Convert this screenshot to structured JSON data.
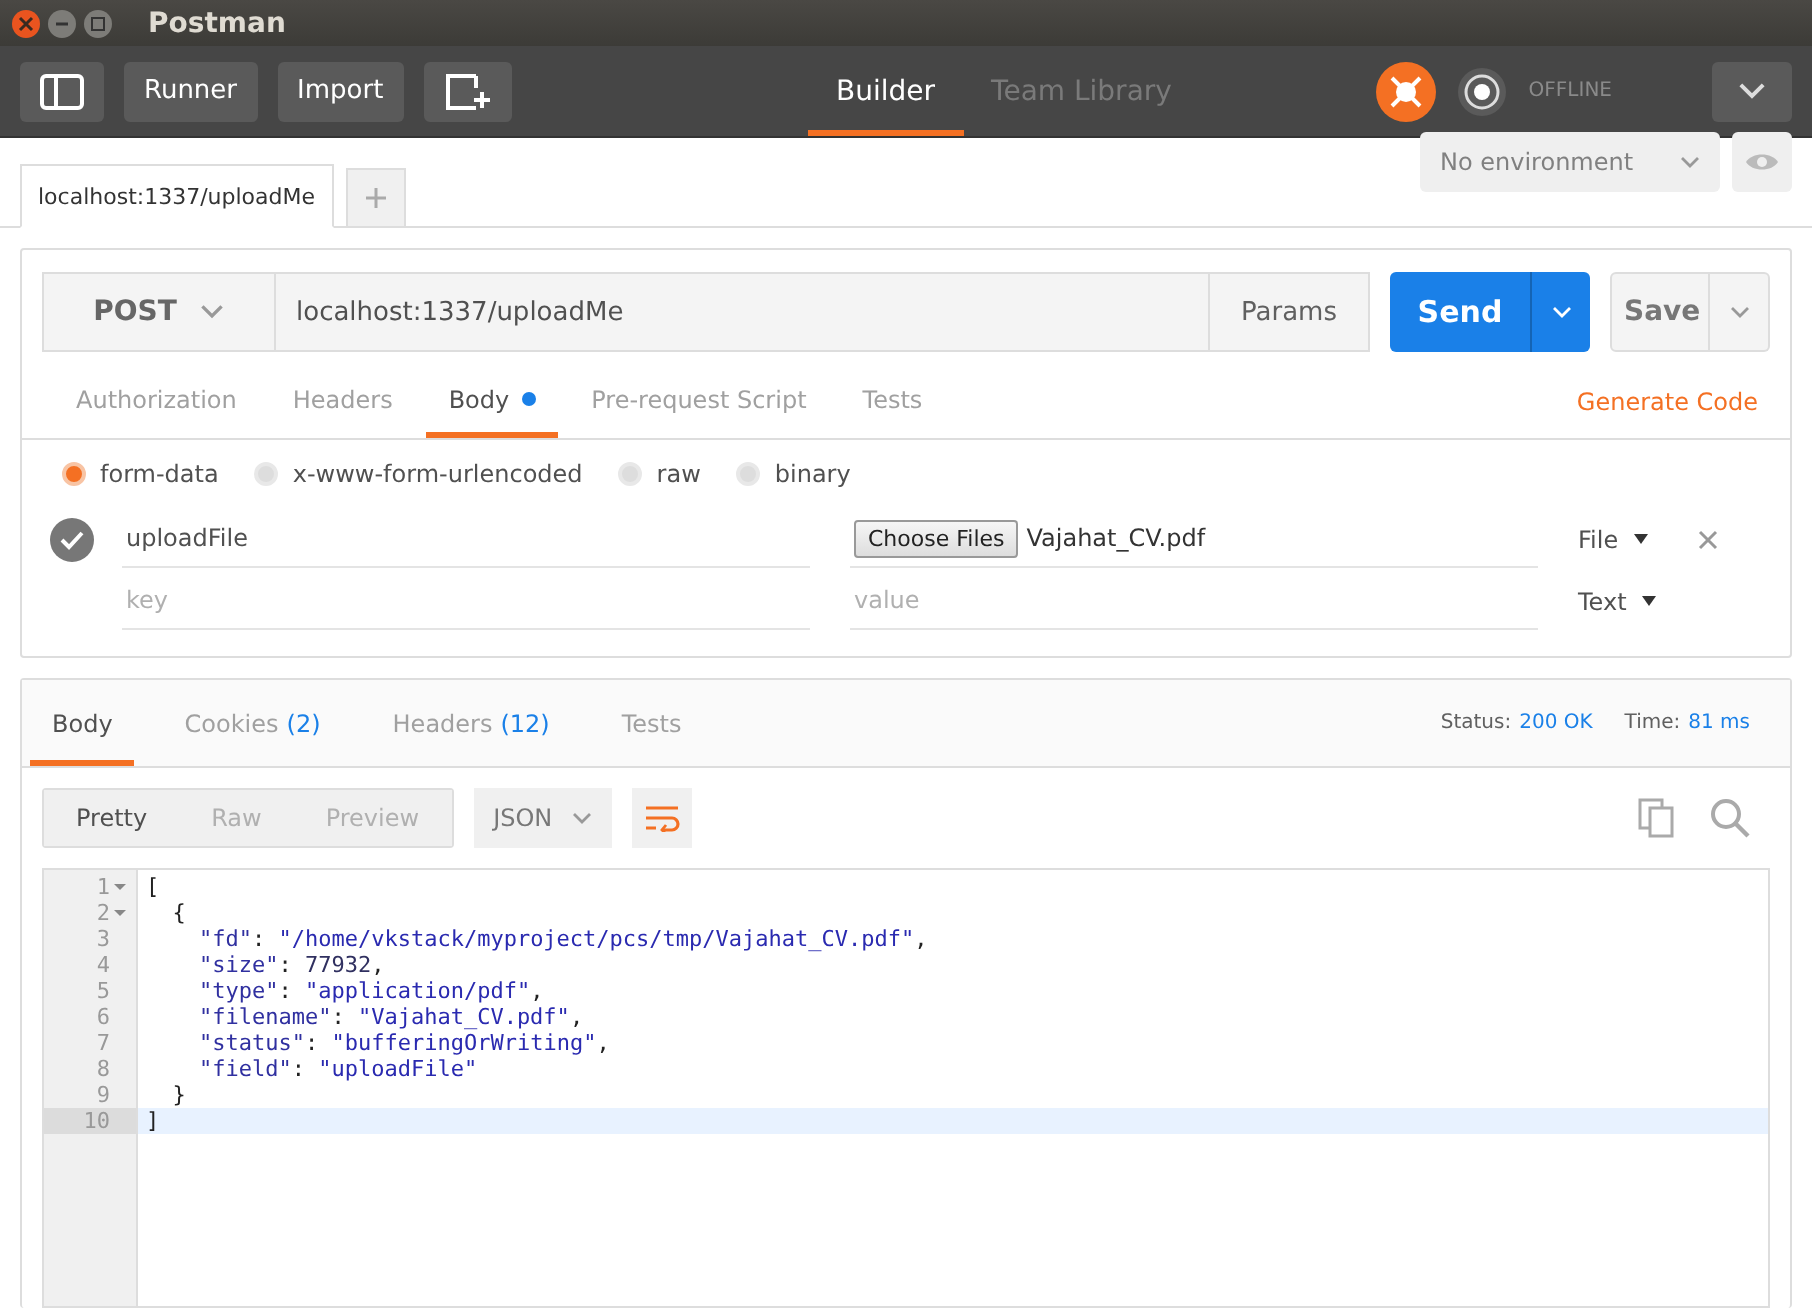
{
  "window": {
    "title": "Postman"
  },
  "toolbar": {
    "buttons": [
      {
        "kind": "sidebar"
      },
      {
        "kind": "text",
        "label": "Runner"
      },
      {
        "kind": "text",
        "label": "Import"
      },
      {
        "kind": "new"
      }
    ],
    "views": [
      {
        "label": "Builder",
        "selected": true
      },
      {
        "label": "Team Library",
        "selected": false
      }
    ],
    "sync_status": "OFFLINE"
  },
  "request_tabs": [
    {
      "label": "localhost:1337/uploadMe",
      "selected": true
    }
  ],
  "environment": {
    "value": "No environment"
  },
  "request": {
    "method": "POST",
    "url": "localhost:1337/uploadMe",
    "params": "Params",
    "send": "Send",
    "save": "Save",
    "tabs": [
      {
        "label": "Authorization",
        "selected": false,
        "dot": false
      },
      {
        "label": "Headers",
        "selected": false,
        "dot": false
      },
      {
        "label": "Body",
        "selected": true,
        "dot": true
      },
      {
        "label": "Pre-request Script",
        "selected": false,
        "dot": false
      },
      {
        "label": "Tests",
        "selected": false,
        "dot": false
      }
    ],
    "generate_code": "Generate Code",
    "body_modes": [
      {
        "label": "form-data",
        "selected": true
      },
      {
        "label": "x-www-form-urlencoded",
        "selected": false
      },
      {
        "label": "raw",
        "selected": false
      },
      {
        "label": "binary",
        "selected": false
      }
    ],
    "form_rows": [
      {
        "checked": true,
        "key": "uploadFile",
        "kind": "file",
        "file_button": "Choose Files",
        "value": "Vajahat_CV.pdf",
        "type": "File"
      },
      {
        "checked": false,
        "key_placeholder": "key",
        "kind": "text",
        "value_placeholder": "value",
        "type": "Text"
      }
    ]
  },
  "response": {
    "tabs": [
      {
        "label": "Body",
        "selected": true
      },
      {
        "label": "Cookies",
        "count": "(2)",
        "selected": false
      },
      {
        "label": "Headers",
        "count": "(12)",
        "selected": false
      },
      {
        "label": "Tests",
        "selected": false
      }
    ],
    "status_label": "Status:",
    "status": "200 OK",
    "time_label": "Time:",
    "time": "81 ms",
    "formats": [
      {
        "label": "Pretty",
        "selected": true
      },
      {
        "label": "Raw",
        "selected": false
      },
      {
        "label": "Preview",
        "selected": false
      }
    ],
    "language": "JSON",
    "code": [
      {
        "n": "1",
        "fold": true,
        "current": false,
        "tokens": [
          {
            "kind": "punct",
            "text": "["
          }
        ]
      },
      {
        "n": "2",
        "fold": true,
        "current": false,
        "tokens": [
          {
            "kind": "punct",
            "text": "  {"
          }
        ]
      },
      {
        "n": "3",
        "fold": false,
        "current": false,
        "tokens": [
          {
            "kind": "key",
            "text": "    \"fd\""
          },
          {
            "kind": "punct",
            "text": ": "
          },
          {
            "kind": "str",
            "text": "\"/home/vkstack/myproject/pcs/tmp/Vajahat_CV.pdf\""
          },
          {
            "kind": "punct",
            "text": ","
          }
        ]
      },
      {
        "n": "4",
        "fold": false,
        "current": false,
        "tokens": [
          {
            "kind": "key",
            "text": "    \"size\""
          },
          {
            "kind": "punct",
            "text": ": "
          },
          {
            "kind": "num",
            "text": "77932"
          },
          {
            "kind": "punct",
            "text": ","
          }
        ]
      },
      {
        "n": "5",
        "fold": false,
        "current": false,
        "tokens": [
          {
            "kind": "key",
            "text": "    \"type\""
          },
          {
            "kind": "punct",
            "text": ": "
          },
          {
            "kind": "str",
            "text": "\"application/pdf\""
          },
          {
            "kind": "punct",
            "text": ","
          }
        ]
      },
      {
        "n": "6",
        "fold": false,
        "current": false,
        "tokens": [
          {
            "kind": "key",
            "text": "    \"filename\""
          },
          {
            "kind": "punct",
            "text": ": "
          },
          {
            "kind": "str",
            "text": "\"Vajahat_CV.pdf\""
          },
          {
            "kind": "punct",
            "text": ","
          }
        ]
      },
      {
        "n": "7",
        "fold": false,
        "current": false,
        "tokens": [
          {
            "kind": "key",
            "text": "    \"status\""
          },
          {
            "kind": "punct",
            "text": ": "
          },
          {
            "kind": "str",
            "text": "\"bufferingOrWriting\""
          },
          {
            "kind": "punct",
            "text": ","
          }
        ]
      },
      {
        "n": "8",
        "fold": false,
        "current": false,
        "tokens": [
          {
            "kind": "key",
            "text": "    \"field\""
          },
          {
            "kind": "punct",
            "text": ": "
          },
          {
            "kind": "str",
            "text": "\"uploadFile\""
          }
        ]
      },
      {
        "n": "9",
        "fold": false,
        "current": false,
        "tokens": [
          {
            "kind": "punct",
            "text": "  }"
          }
        ]
      },
      {
        "n": "10",
        "fold": false,
        "current": true,
        "tokens": [
          {
            "kind": "punct",
            "text": "]"
          }
        ]
      }
    ]
  }
}
